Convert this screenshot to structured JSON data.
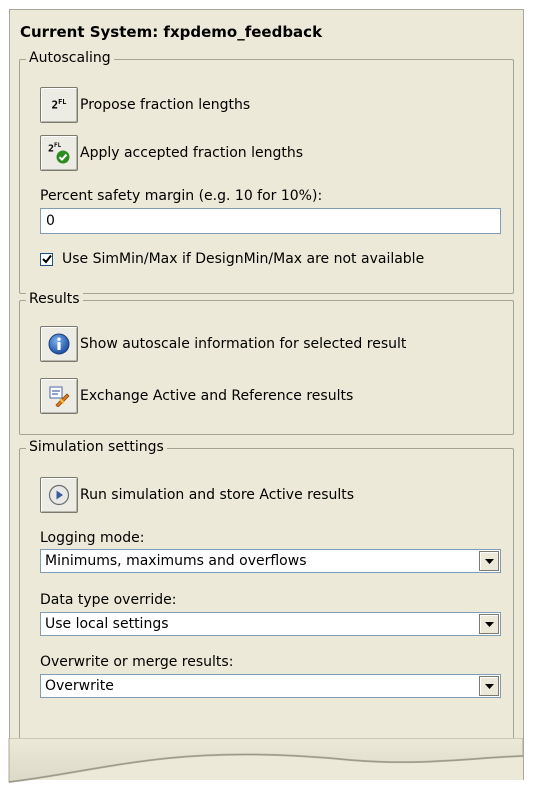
{
  "header": {
    "title": "Current System: fxpdemo_feedback"
  },
  "autoscaling": {
    "legend": "Autoscaling",
    "propose_icon_text": "2ᴿᴸ",
    "propose_label": "Propose fraction lengths",
    "apply_label": "Apply accepted fraction lengths",
    "margin_label": "Percent safety margin (e.g. 10 for 10%):",
    "margin_value": "0",
    "simminmax_label": "Use SimMin/Max if DesignMin/Max are not available",
    "simminmax_checked": true
  },
  "results": {
    "legend": "Results",
    "show_info_label": "Show autoscale information for selected result",
    "exchange_label": "Exchange Active and Reference results"
  },
  "simulation": {
    "legend": "Simulation settings",
    "run_label": "Run simulation and store Active results",
    "logging_label": "Logging mode:",
    "logging_value": "Minimums, maximums and overflows",
    "override_label": "Data type override:",
    "override_value": "Use local settings",
    "overwrite_label": "Overwrite or merge results:",
    "overwrite_value": "Overwrite"
  },
  "colors": {
    "panel_bg": "#ece9d8",
    "group_border": "#a5a393",
    "accent_green": "#2e8b22",
    "info_blue": "#1d5fb8"
  }
}
